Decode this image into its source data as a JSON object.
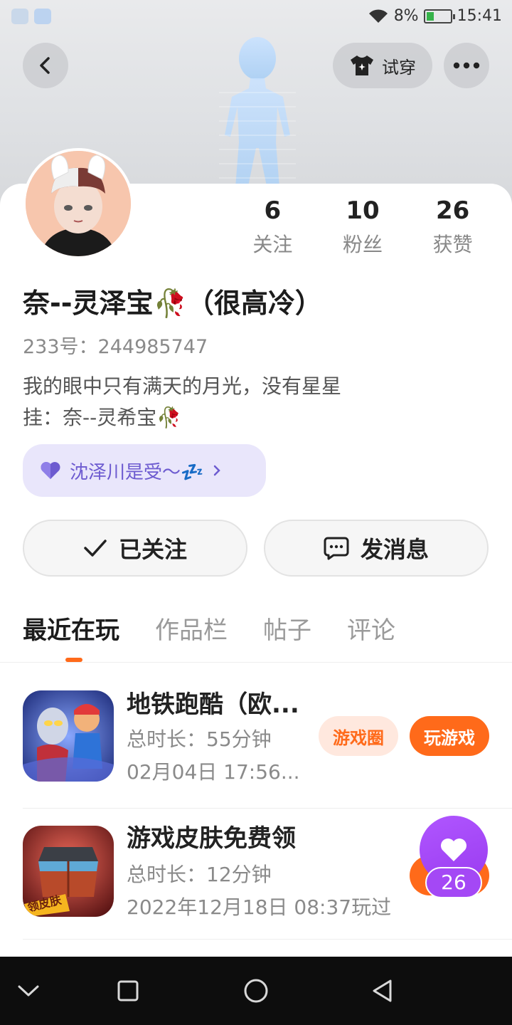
{
  "status_bar": {
    "battery": "8%",
    "time": "15:41",
    "battery_level": 0.08
  },
  "header": {
    "tryon_label": "试穿"
  },
  "profile": {
    "stats": [
      {
        "value": "6",
        "label": "关注"
      },
      {
        "value": "10",
        "label": "粉丝"
      },
      {
        "value": "26",
        "label": "获赞"
      }
    ],
    "username": "奈--灵泽宝🥀（很高冷）",
    "user_id": "233号：244985747",
    "bio_line1": "我的眼中只有满天的月光，没有星星",
    "bio_line2": "挂：奈--灵希宝🥀",
    "cp_tag": "沈泽川是受～💤"
  },
  "actions": {
    "follow_label": "已关注",
    "message_label": "发消息"
  },
  "tabs": [
    {
      "label": "最近在玩"
    },
    {
      "label": "作品栏"
    },
    {
      "label": "帖子"
    },
    {
      "label": "评论"
    }
  ],
  "games": [
    {
      "title": "地铁跑酷（欧...",
      "duration": "总时长：55分钟",
      "last_played": "02月04日 17:56...",
      "circle_label": "游戏圈",
      "play_label": "玩游戏"
    },
    {
      "title": "游戏皮肤免费领",
      "duration": "总时长：12分钟",
      "last_played": "2022年12月18日 08:37玩过",
      "icon_badge": "领皮肤"
    }
  ],
  "like_float": {
    "count": "26"
  },
  "colors": {
    "accent": "#ff6a1a",
    "cp_tag_text": "#6d5bd0",
    "like_purple": "#a448f5"
  }
}
